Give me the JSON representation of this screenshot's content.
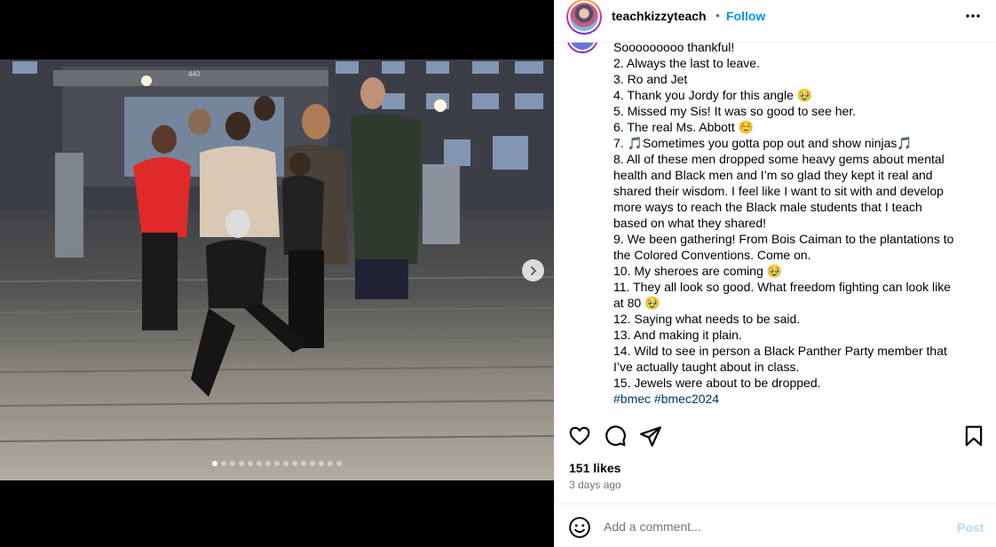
{
  "post": {
    "username": "teachkizzyteach",
    "separator": "•",
    "follow_label": "Follow",
    "more_icon": "more-horizontal-icon"
  },
  "media": {
    "building_number": "440",
    "carousel": {
      "total": 15,
      "active_index": 0
    },
    "next_icon": "chevron-right-icon"
  },
  "caption": {
    "lines": [
      "Sooooooooo thankful!",
      "2. Always the last to leave.",
      "3. Ro and Jet",
      "4. Thank you Jordy for this angle 🥹",
      "5. Missed my Sis! It was so good to see her.",
      "6. The real Ms. Abbott ☺️",
      "7. 🎵Sometimes you gotta pop out and show ninjas🎵",
      "8. All of these men dropped some heavy gems about mental",
      "health and Black men and I’m so glad they kept it real and",
      "shared their wisdom. I feel like I want to sit with and develop",
      "more ways to reach the Black male students that I teach",
      "based on what they shared!",
      "9. We been gathering! From Bois Caiman to the plantations to",
      "the Colored Conventions. Come on.",
      "10. My sheroes are coming 🥹",
      "11. They all look so good. What freedom fighting can look like",
      "at 80 🥹",
      "12. Saying what needs to be said.",
      "13. And making it plain.",
      "14. Wild to see in person a Black Panther Party member that",
      "I’ve actually taught about in class.",
      "15. Jewels were about to be dropped."
    ],
    "hashtags": [
      "#bmec",
      "#bmec2024"
    ]
  },
  "actions": {
    "like_icon": "heart-icon",
    "comment_icon": "comment-icon",
    "share_icon": "share-icon",
    "save_icon": "bookmark-icon"
  },
  "stats": {
    "likes": "151 likes",
    "time": "3 days ago"
  },
  "comment": {
    "emoji_icon": "emoji-icon",
    "placeholder": "Add a comment...",
    "post_label": "Post"
  },
  "colors": {
    "link": "#0095f6",
    "hashtag": "#00376b",
    "muted": "#737373",
    "post_disabled": "#b3dbff",
    "divider": "#efefef"
  }
}
